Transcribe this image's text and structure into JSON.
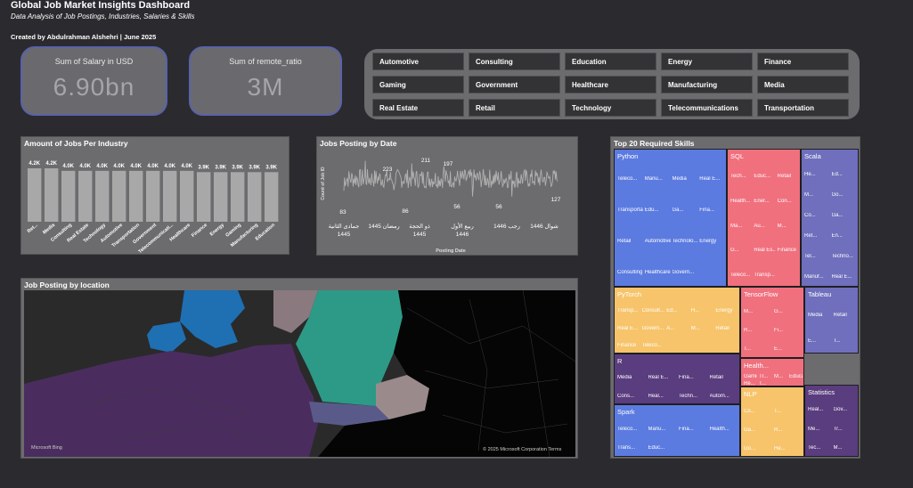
{
  "header": {
    "title": "Global Job Market Insights Dashboard",
    "subtitle": "Data Analysis of Job Postings, Industries, Salaries & Skills",
    "credit": "Created by Abdulrahman Alshehri | June 2025"
  },
  "kpis": [
    {
      "label": "Sum of Salary in USD",
      "value": "6.90bn"
    },
    {
      "label": "Sum of remote_ratio",
      "value": "3M"
    }
  ],
  "industries": [
    "Automotive",
    "Consulting",
    "Education",
    "Energy",
    "Finance",
    "Gaming",
    "Government",
    "Healthcare",
    "Manufacturing",
    "Media",
    "Real Estate",
    "Retail",
    "Technology",
    "Telecommunications",
    "Transportation"
  ],
  "bar_panel": {
    "title": "Amount of Jobs Per Industry"
  },
  "date_panel": {
    "title": "Jobs Posting by Date"
  },
  "skills_panel": {
    "title": "Top 20 Required Skills"
  },
  "map_panel": {
    "title": "Job Posting by location",
    "logo": "Microsoft Bing",
    "copyright": "© 2025 Microsoft Corporation Terms"
  },
  "chart_data": [
    {
      "type": "bar",
      "title": "Amount of Jobs Per Industry",
      "categories": [
        "Ret...",
        "Media",
        "Consulting",
        "Real Estate",
        "Technology",
        "Automotive",
        "Transportation",
        "Government",
        "Telecommunicati...",
        "Healthcare",
        "Finance",
        "Energy",
        "Gaming",
        "Manufacturing",
        "Education"
      ],
      "values": [
        4200,
        4200,
        4000,
        4000,
        4000,
        4000,
        4000,
        4000,
        4000,
        4000,
        3900,
        3900,
        3900,
        3900,
        3900
      ],
      "data_labels": [
        "4.2K",
        "4.2K",
        "4.0K",
        "4.0K",
        "4.0K",
        "4.0K",
        "4.0K",
        "4.0K",
        "4.0K",
        "4.0K",
        "3.9K",
        "3.9K",
        "3.9K",
        "3.9K",
        "3.9K"
      ],
      "color": "#a8a8a8"
    },
    {
      "type": "line",
      "title": "Jobs Posting by Date",
      "xlabel": "Posting Date",
      "ylabel": "Count of Job ID",
      "x_ticks": [
        [
          "جمادى الثانية",
          "1445"
        ],
        [
          "رمضان 1445"
        ],
        [
          "ذو الحجة",
          "1445"
        ],
        [
          "ربيع الأول",
          "1446"
        ],
        [
          "رجب 1446"
        ],
        [
          "شوال 1446"
        ]
      ],
      "annotations": [
        {
          "label": "83",
          "value": 83
        },
        {
          "label": "223",
          "value": 223
        },
        {
          "label": "86",
          "value": 86
        },
        {
          "label": "211",
          "value": 211
        },
        {
          "label": "197",
          "value": 197
        },
        {
          "label": "56",
          "value": 56
        },
        {
          "label": "56",
          "value": 56
        },
        {
          "label": "127",
          "value": 127
        }
      ],
      "color": "#b0b0b0"
    },
    {
      "type": "treemap",
      "title": "Top 20 Required Skills",
      "items": [
        {
          "name": "Python",
          "color": "#5b7be0",
          "subs": [
            "Teleco...",
            "Manu...",
            "Media",
            "Real E...",
            "Transportati...",
            "Edu...",
            "Ga...",
            "Fina...",
            "Retail",
            "Automotive",
            "Technolo...",
            "Energy",
            "Consulting",
            "Healthcare",
            "Govern..."
          ]
        },
        {
          "name": "SQL",
          "color": "#f0707e",
          "subs": [
            "Tech...",
            "Educ...",
            "Retail",
            "Health...",
            "Ener...",
            "Con...",
            "Ma...",
            "Au...",
            "M...",
            "G...",
            "Real Es...",
            "Finance",
            "Teleco...",
            "Transp..."
          ]
        },
        {
          "name": "Scala",
          "color": "#6f6fbd",
          "subs": [
            "He...",
            "Ed...",
            "M...",
            "Go...",
            "Co...",
            "Ga...",
            "Ret...",
            "En...",
            "Tel...",
            "Techno...",
            "Manuf...",
            "Real E..."
          ]
        },
        {
          "name": "PyTorch",
          "color": "#f7c46b",
          "subs": [
            "Transp...",
            "Consult...",
            "Ed...",
            "H...",
            "Energy",
            "Real E...",
            "Govern...",
            "A...",
            "M...",
            "Retail",
            "Finance",
            "Teleco..."
          ]
        },
        {
          "name": "TensorFlow",
          "color": "#f0707e",
          "subs": [
            "M...",
            "G...",
            "R...",
            "Fi...",
            "T...",
            "E..."
          ]
        },
        {
          "name": "Tableau",
          "color": "#6f6fbd",
          "subs": [
            "Media",
            "Retail",
            "E...",
            "T..."
          ]
        },
        {
          "name": "R",
          "color": "#5a3d7e",
          "subs": [
            "Media",
            "Real E...",
            "Fina...",
            "Retail",
            "Cons...",
            "Heal...",
            "Techn...",
            "Autom..."
          ]
        },
        {
          "name": "Health...",
          "color": "#f0707e",
          "subs": [
            "Gaming",
            "Tr...",
            "M...",
            "Educa...",
            "Re...",
            "T..."
          ]
        },
        {
          "name": "Spark",
          "color": "#5b7be0",
          "subs": [
            "Teleco...",
            "Manu...",
            "Fina...",
            "Health...",
            "Trans...",
            "Educ..."
          ]
        },
        {
          "name": "NLP",
          "color": "#f7c46b",
          "subs": [
            "Co...",
            "T...",
            "Ga...",
            "R...",
            "Go...",
            "He..."
          ]
        },
        {
          "name": "Statistics",
          "color": "#5a3d7e",
          "subs": [
            "Real...",
            "Gov...",
            "Me...",
            "Tr...",
            "Tec...",
            "M..."
          ]
        }
      ]
    }
  ]
}
